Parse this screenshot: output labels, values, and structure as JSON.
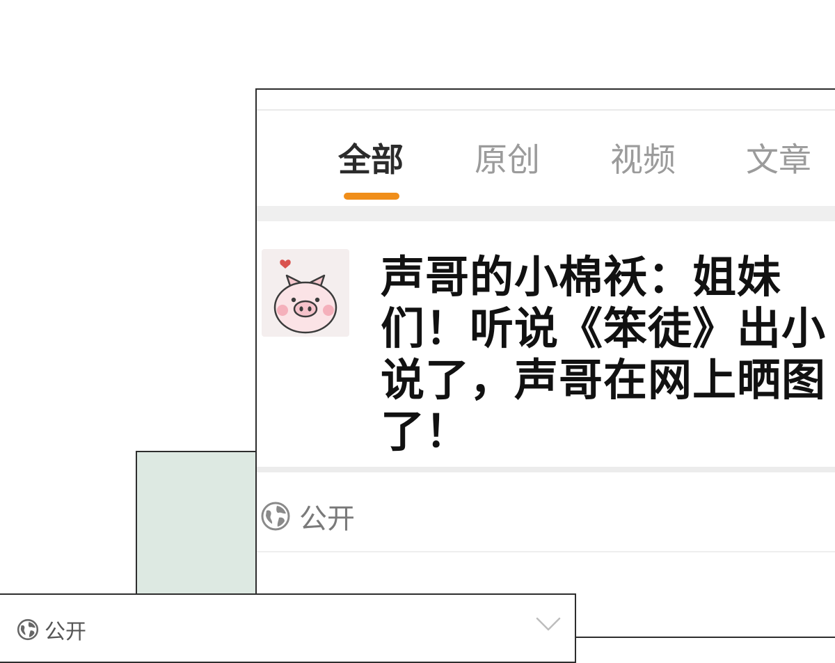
{
  "tabs": [
    {
      "label": "全部",
      "active": true
    },
    {
      "label": "原创",
      "active": false
    },
    {
      "label": "视频",
      "active": false
    },
    {
      "label": "文章",
      "active": false
    }
  ],
  "post": {
    "text": "声哥的小棉袄：姐妹们！听说《笨徒》出小说了，声哥在网上晒图了！",
    "avatar_icon": "pig-avatar-icon"
  },
  "visibility": {
    "label": "公开",
    "icon": "globe-icon"
  },
  "bottom_bar": {
    "label": "公开",
    "icon": "globe-icon",
    "dropdown_icon": "chevron-down-icon"
  },
  "colors": {
    "accent": "#f08e1a",
    "tab_active": "#2b2b2b",
    "tab_inactive": "#9b9b9b",
    "green_panel": "#dde9e2"
  }
}
